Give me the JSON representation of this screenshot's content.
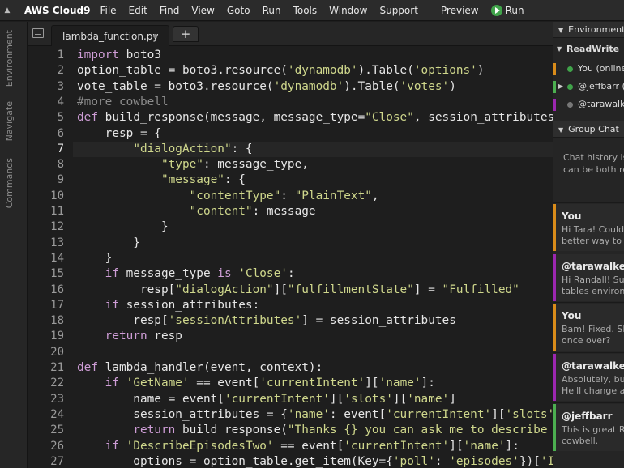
{
  "menubar": {
    "collapse_icon": "▲",
    "brand": "AWS Cloud9",
    "menus": [
      "File",
      "Edit",
      "Find",
      "View",
      "Goto",
      "Run",
      "Tools",
      "Window",
      "Support"
    ],
    "preview": "Preview",
    "run": "Run",
    "run_color": "#40a34a"
  },
  "left_tabs": [
    "Environment",
    "Navigate",
    "Commands"
  ],
  "tabs": {
    "file_tab": "lambda_function.py",
    "plus": "+"
  },
  "editor": {
    "active_line": 7,
    "modified_line": 4,
    "line_numbers": [
      "1",
      "2",
      "3",
      "4",
      "5",
      "6",
      "7",
      "8",
      "9",
      "10",
      "11",
      "12",
      "13",
      "14",
      "15",
      "16",
      "17",
      "18",
      "19",
      "20",
      "21",
      "22",
      "23",
      "24",
      "25",
      "26",
      "27"
    ],
    "lines": [
      [
        [
          "k",
          "import"
        ],
        [
          "p",
          " boto3"
        ]
      ],
      [
        [
          "p",
          "option_table = boto3.resource("
        ],
        [
          "s",
          "'dynamodb'"
        ],
        [
          "p",
          ").Table("
        ],
        [
          "s",
          "'options'"
        ],
        [
          "p",
          ")"
        ]
      ],
      [
        [
          "p",
          "vote_table = boto3.resource("
        ],
        [
          "s",
          "'dynamodb'"
        ],
        [
          "p",
          ").Table("
        ],
        [
          "s",
          "'votes'"
        ],
        [
          "p",
          ")"
        ]
      ],
      [
        [
          "c",
          "#more cowbell"
        ]
      ],
      [
        [
          "k",
          "def"
        ],
        [
          "p",
          " build_response(message, message_type="
        ],
        [
          "s",
          "\"Close\""
        ],
        [
          "p",
          ", session_attributes="
        ]
      ],
      [
        [
          "p",
          "    resp = {"
        ]
      ],
      [
        [
          "p",
          "        "
        ],
        [
          "s",
          "\"dialogAction\""
        ],
        [
          "p",
          ": {"
        ]
      ],
      [
        [
          "p",
          "            "
        ],
        [
          "s",
          "\"type\""
        ],
        [
          "p",
          ": message_type,"
        ]
      ],
      [
        [
          "p",
          "            "
        ],
        [
          "s",
          "\"message\""
        ],
        [
          "p",
          ": {"
        ]
      ],
      [
        [
          "p",
          "                "
        ],
        [
          "s",
          "\"contentType\""
        ],
        [
          "p",
          ": "
        ],
        [
          "s",
          "\"PlainText\""
        ],
        [
          "p",
          ","
        ]
      ],
      [
        [
          "p",
          "                "
        ],
        [
          "s",
          "\"content\""
        ],
        [
          "p",
          ": message"
        ]
      ],
      [
        [
          "p",
          "            }"
        ]
      ],
      [
        [
          "p",
          "        }"
        ]
      ],
      [
        [
          "p",
          "    }"
        ]
      ],
      [
        [
          "p",
          "    "
        ],
        [
          "k",
          "if"
        ],
        [
          "p",
          " message_type "
        ],
        [
          "k",
          "is"
        ],
        [
          "p",
          " "
        ],
        [
          "s",
          "'Close'"
        ],
        [
          "p",
          ":"
        ]
      ],
      [
        [
          "p",
          "         resp["
        ],
        [
          "s",
          "\"dialogAction\""
        ],
        [
          "p",
          "]["
        ],
        [
          "s",
          "\"fulfillmentState\""
        ],
        [
          "p",
          "] = "
        ],
        [
          "s",
          "\"Fulfilled\""
        ]
      ],
      [
        [
          "p",
          "    "
        ],
        [
          "k",
          "if"
        ],
        [
          "p",
          " session_attributes:"
        ]
      ],
      [
        [
          "p",
          "        resp["
        ],
        [
          "s",
          "'sessionAttributes'"
        ],
        [
          "p",
          "] = session_attributes"
        ]
      ],
      [
        [
          "p",
          "    "
        ],
        [
          "k",
          "return"
        ],
        [
          "p",
          " resp"
        ]
      ],
      [
        [
          "p",
          ""
        ]
      ],
      [
        [
          "k",
          "def"
        ],
        [
          "p",
          " lambda_handler(event, context):"
        ]
      ],
      [
        [
          "p",
          "    "
        ],
        [
          "k",
          "if"
        ],
        [
          "p",
          " "
        ],
        [
          "s",
          "'GetName'"
        ],
        [
          "p",
          " == event["
        ],
        [
          "s",
          "'currentIntent'"
        ],
        [
          "p",
          "]["
        ],
        [
          "s",
          "'name'"
        ],
        [
          "p",
          "]:"
        ]
      ],
      [
        [
          "p",
          "        name = event["
        ],
        [
          "s",
          "'currentIntent'"
        ],
        [
          "p",
          "]["
        ],
        [
          "s",
          "'slots'"
        ],
        [
          "p",
          "]["
        ],
        [
          "s",
          "'name'"
        ],
        [
          "p",
          "]"
        ]
      ],
      [
        [
          "p",
          "        session_attributes = {"
        ],
        [
          "s",
          "'name'"
        ],
        [
          "p",
          ": event["
        ],
        [
          "s",
          "'currentIntent'"
        ],
        [
          "p",
          "]["
        ],
        [
          "s",
          "'slots'"
        ],
        [
          "p",
          "]"
        ]
      ],
      [
        [
          "p",
          "        "
        ],
        [
          "k",
          "return"
        ],
        [
          "p",
          " build_response("
        ],
        [
          "s",
          "\"Thanks {} you can ask me to describe t"
        ]
      ],
      [
        [
          "p",
          "    "
        ],
        [
          "k",
          "if"
        ],
        [
          "p",
          " "
        ],
        [
          "s",
          "'DescribeEpisodesTwo'"
        ],
        [
          "p",
          " == event["
        ],
        [
          "s",
          "'currentIntent'"
        ],
        [
          "p",
          "]["
        ],
        [
          "s",
          "'name'"
        ],
        [
          "p",
          "]:"
        ]
      ],
      [
        [
          "p",
          "        options = option_table.get_item(Key={"
        ],
        [
          "s",
          "'poll'"
        ],
        [
          "p",
          ": "
        ],
        [
          "s",
          "'episodes'"
        ],
        [
          "p",
          "})["
        ],
        [
          "s",
          "'It"
        ]
      ]
    ]
  },
  "right_panel": {
    "env_header": "Environment M",
    "readwrite_label": "ReadWrite",
    "members": [
      {
        "name": "You (online)",
        "status_color": "#40a34a",
        "bar_color": "#d98c1a",
        "has_arrow": false
      },
      {
        "name": "@jeffbarr (o",
        "status_color": "#40a34a",
        "bar_color": "#4caf50",
        "has_arrow": true
      },
      {
        "name": "@tarawalker",
        "status_color": "#777777",
        "bar_color": "#9c27b0",
        "has_arrow": false
      }
    ],
    "group_chat_header": "Group Chat",
    "chat_hint_1": "Chat history is s",
    "chat_hint_2": "can be both re",
    "messages": [
      {
        "author": "You",
        "line1": "Hi Tara! Could",
        "line2": "better way to u",
        "bar_color": "#d98c1a"
      },
      {
        "author": "@tarawalker",
        "line1": "Hi Randall! Su",
        "line2": "tables environ",
        "bar_color": "#9c27b0"
      },
      {
        "author": "You",
        "line1": "Bam! Fixed. Sl",
        "line2": "once over?",
        "bar_color": "#d98c1a"
      },
      {
        "author": "@tarawalker",
        "line1": "Absolutely, but",
        "line2": "He'll change a",
        "bar_color": "#9c27b0"
      },
      {
        "author": "@jeffbarr",
        "line1": "This is great R",
        "line2": "cowbell.",
        "bar_color": "#4caf50"
      }
    ]
  }
}
